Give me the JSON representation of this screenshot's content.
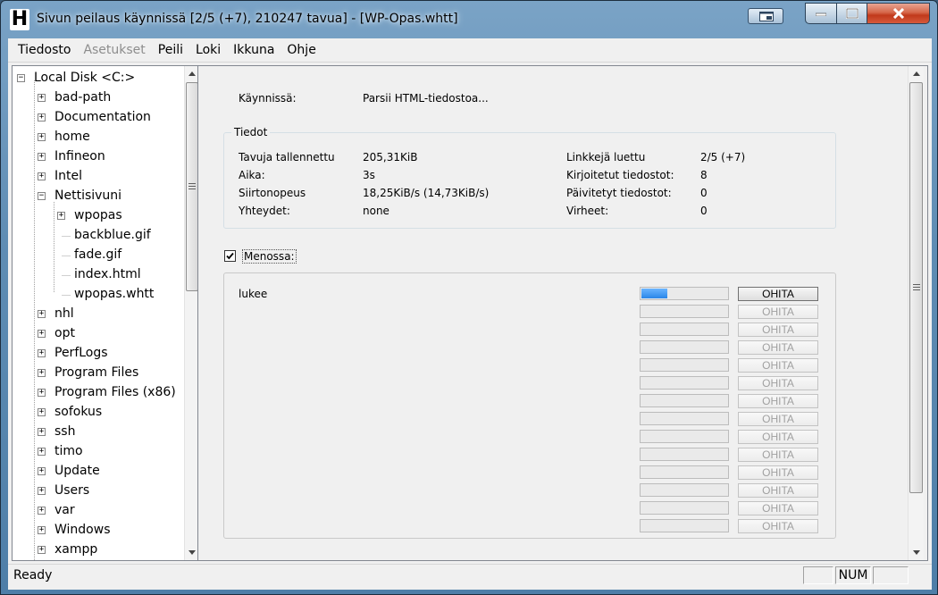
{
  "window": {
    "title": "Sivun peilaus käynnissä [2/5 (+7), 210247 tavua] - [WP-Opas.whtt]",
    "app_letter": "H"
  },
  "menu": [
    {
      "label": "Tiedosto",
      "enabled": true
    },
    {
      "label": "Asetukset",
      "enabled": false
    },
    {
      "label": "Peili",
      "enabled": true
    },
    {
      "label": "Loki",
      "enabled": true
    },
    {
      "label": "Ikkuna",
      "enabled": true
    },
    {
      "label": "Ohje",
      "enabled": true
    }
  ],
  "tree": {
    "root": "Local Disk <C:>",
    "items": [
      {
        "label": "bad-path",
        "expander": "+"
      },
      {
        "label": "Documentation",
        "expander": "+"
      },
      {
        "label": "home",
        "expander": "+"
      },
      {
        "label": "Infineon",
        "expander": "+"
      },
      {
        "label": "Intel",
        "expander": "+"
      },
      {
        "label": "Nettisivuni",
        "expander": "-"
      },
      {
        "label": "wpopas",
        "expander": "+"
      },
      {
        "label": "backblue.gif",
        "expander": ""
      },
      {
        "label": "fade.gif",
        "expander": ""
      },
      {
        "label": "index.html",
        "expander": ""
      },
      {
        "label": "wpopas.whtt",
        "expander": ""
      },
      {
        "label": "nhl",
        "expander": "+"
      },
      {
        "label": "opt",
        "expander": "+"
      },
      {
        "label": "PerfLogs",
        "expander": "+"
      },
      {
        "label": "Program Files",
        "expander": "+"
      },
      {
        "label": "Program Files (x86)",
        "expander": "+"
      },
      {
        "label": "sofokus",
        "expander": "+"
      },
      {
        "label": "ssh",
        "expander": "+"
      },
      {
        "label": "timo",
        "expander": "+"
      },
      {
        "label": "Update",
        "expander": "+"
      },
      {
        "label": "Users",
        "expander": "+"
      },
      {
        "label": "var",
        "expander": "+"
      },
      {
        "label": "Windows",
        "expander": "+"
      },
      {
        "label": "xampp",
        "expander": "+"
      }
    ]
  },
  "status_main": {
    "label": "Käynnissä:",
    "value": "Parsii HTML-tiedostoa..."
  },
  "info": {
    "title": "Tiedot",
    "left": [
      {
        "label": "Tavuja tallennettu",
        "value": "205,31KiB"
      },
      {
        "label": "Aika:",
        "value": "3s"
      },
      {
        "label": "Siirtonopeus",
        "value": "18,25KiB/s (14,73KiB/s)"
      },
      {
        "label": "Yhteydet:",
        "value": "none"
      }
    ],
    "right": [
      {
        "label": "Linkkejä luettu",
        "value": "2/5 (+7)"
      },
      {
        "label": "Kirjoitetut tiedostot:",
        "value": "8"
      },
      {
        "label": "Päivitetyt tiedostot:",
        "value": "0"
      },
      {
        "label": "Virheet:",
        "value": "0"
      }
    ]
  },
  "in_progress": {
    "label": "Menossa:",
    "checked": true,
    "skip_label": "OHITA",
    "rows": [
      {
        "name": "lukee",
        "progress": 0.3,
        "active": true
      },
      {
        "name": "",
        "progress": 0,
        "active": false
      },
      {
        "name": "",
        "progress": 0,
        "active": false
      },
      {
        "name": "",
        "progress": 0,
        "active": false
      },
      {
        "name": "",
        "progress": 0,
        "active": false
      },
      {
        "name": "",
        "progress": 0,
        "active": false
      },
      {
        "name": "",
        "progress": 0,
        "active": false
      },
      {
        "name": "",
        "progress": 0,
        "active": false
      },
      {
        "name": "",
        "progress": 0,
        "active": false
      },
      {
        "name": "",
        "progress": 0,
        "active": false
      },
      {
        "name": "",
        "progress": 0,
        "active": false
      },
      {
        "name": "",
        "progress": 0,
        "active": false
      },
      {
        "name": "",
        "progress": 0,
        "active": false
      },
      {
        "name": "",
        "progress": 0,
        "active": false
      }
    ]
  },
  "statusbar": {
    "text": "Ready",
    "num": "NUM"
  }
}
